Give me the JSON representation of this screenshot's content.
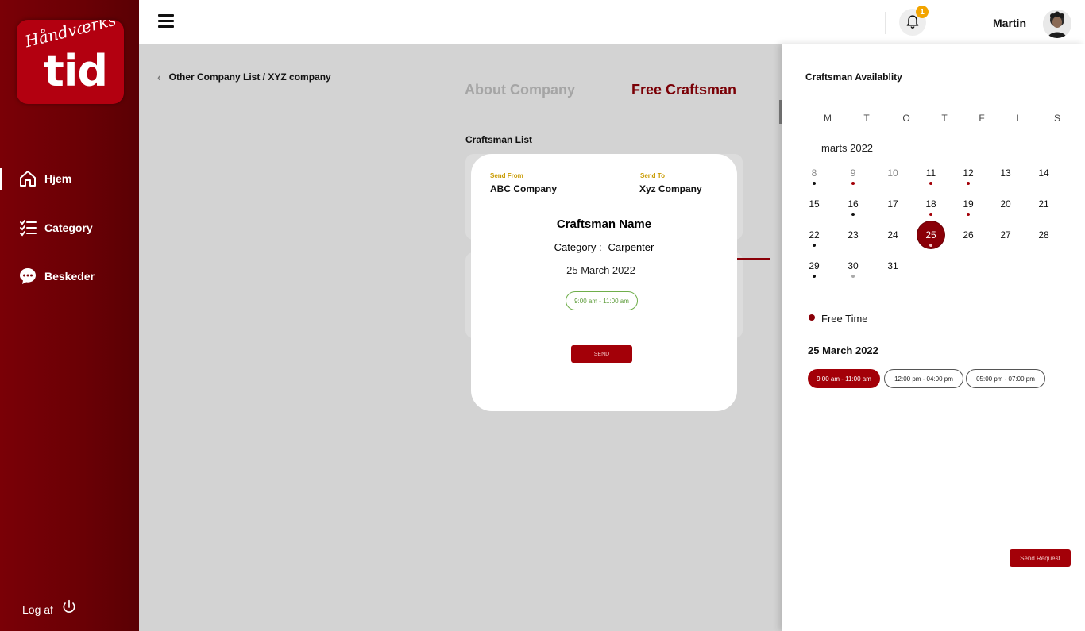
{
  "brand": {
    "logo_script": "Håndværks",
    "logo_big": "tid",
    "primary_color": "#7a0006",
    "accent_color": "#a30008"
  },
  "sidebar": {
    "items": [
      {
        "label": "Hjem",
        "icon": "home-icon",
        "active": true
      },
      {
        "label": "Category",
        "icon": "list-check-icon",
        "active": false
      },
      {
        "label": "Beskeder",
        "icon": "chat-icon",
        "active": false
      }
    ],
    "logout_label": "Log af"
  },
  "topbar": {
    "notification_count": "1",
    "user_name": "Martin"
  },
  "breadcrumb": "Other Company List / XYZ company",
  "tabs": [
    {
      "label": "About Company",
      "active": false
    },
    {
      "label": "Free Craftsman",
      "active": true
    }
  ],
  "section_title": "Craftsman List",
  "modal": {
    "send_from_label": "Send From",
    "send_from_value": "ABC Company",
    "send_to_label": "Send To",
    "send_to_value": "Xyz Company",
    "craftsman_name": "Craftsman Name",
    "category": "Category :- Carpenter",
    "date": "25 March 2022",
    "time_slot": "9:00 am - 11:00 am",
    "send_label": "SEND"
  },
  "availability": {
    "title": "Craftsman Availablity",
    "weekdays": [
      "M",
      "T",
      "O",
      "T",
      "F",
      "L",
      "S"
    ],
    "month_label": "marts 2022",
    "weeks": [
      [
        {
          "d": "8",
          "muted": true,
          "dot": "black"
        },
        {
          "d": "9",
          "muted": true,
          "dot": "red"
        },
        {
          "d": "10",
          "muted": true,
          "dot": ""
        },
        {
          "d": "11",
          "dot": "red"
        },
        {
          "d": "12",
          "dot": "red"
        },
        {
          "d": "13",
          "dot": ""
        },
        {
          "d": "14",
          "dot": ""
        }
      ],
      [
        {
          "d": "15",
          "dot": ""
        },
        {
          "d": "16",
          "dot": "black"
        },
        {
          "d": "17",
          "dot": ""
        },
        {
          "d": "18",
          "dot": "red"
        },
        {
          "d": "19",
          "dot": "red"
        },
        {
          "d": "20",
          "dot": ""
        },
        {
          "d": "21",
          "dot": ""
        }
      ],
      [
        {
          "d": "22",
          "dot": "black"
        },
        {
          "d": "23",
          "dot": ""
        },
        {
          "d": "24",
          "dot": ""
        },
        {
          "d": "25",
          "selected": true,
          "dot": "white"
        },
        {
          "d": "26",
          "dot": ""
        },
        {
          "d": "27",
          "dot": ""
        },
        {
          "d": "28",
          "dot": ""
        }
      ],
      [
        {
          "d": "29",
          "dot": "black"
        },
        {
          "d": "30",
          "dot": "gray"
        },
        {
          "d": "31",
          "dot": ""
        }
      ]
    ],
    "legend_label": "Free Time",
    "selected_date": "25 March 2022",
    "slots": [
      {
        "label": "9:00 am - 11:00 am",
        "active": true
      },
      {
        "label": "12:00 pm - 04:00 pm",
        "active": false
      },
      {
        "label": "05:00 pm - 07:00 pm",
        "active": false
      }
    ],
    "send_request_label": "Send Request"
  }
}
